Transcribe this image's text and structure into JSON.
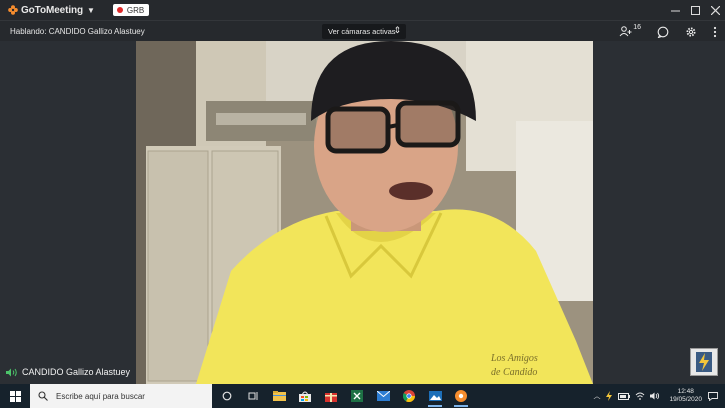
{
  "titlebar": {
    "app_name": "GoToMeeting",
    "rec_label": "GRB",
    "colors": {
      "accent": "#f68d2e",
      "record": "#e02b2b"
    }
  },
  "toolbar": {
    "speaking_text": "Hablando: CANDIDO Gallizo Alastuey",
    "camera_select": "Ver cámaras activas",
    "attendee_count": "16"
  },
  "video": {
    "participant_name": "CANDIDO Gallizo Alastuey",
    "shirt_text_line1": "Los Amigos",
    "shirt_text_line2": "de Candido"
  },
  "taskbar": {
    "search_placeholder": "Escribe aquí para buscar",
    "time": "12:48",
    "date": "19/05/2020"
  }
}
